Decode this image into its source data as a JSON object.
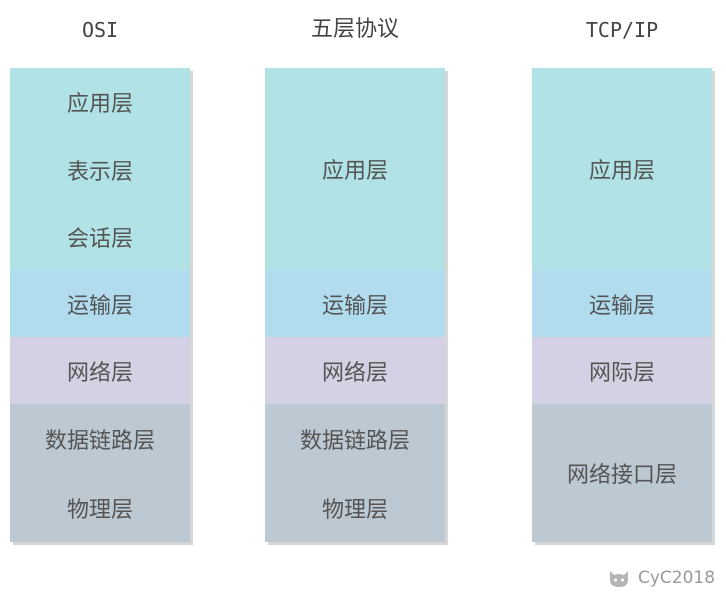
{
  "columns": [
    {
      "title": "OSI",
      "layers": [
        "应用层",
        "表示层",
        "会话层",
        "运输层",
        "网络层",
        "数据链路层",
        "物理层"
      ]
    },
    {
      "title": "五层协议",
      "layers": [
        "应用层",
        "运输层",
        "网络层",
        "数据链路层",
        "物理层"
      ]
    },
    {
      "title": "TCP/IP",
      "layers": [
        "应用层",
        "运输层",
        "网际层",
        "网络接口层"
      ]
    }
  ],
  "watermark": {
    "text": "CyC2018",
    "icon": "github-cat-icon"
  },
  "colors": {
    "application": "#b0e2e6",
    "transport": "#b0dcee",
    "network": "#d3d1e3",
    "link": "#bcc8d2"
  }
}
